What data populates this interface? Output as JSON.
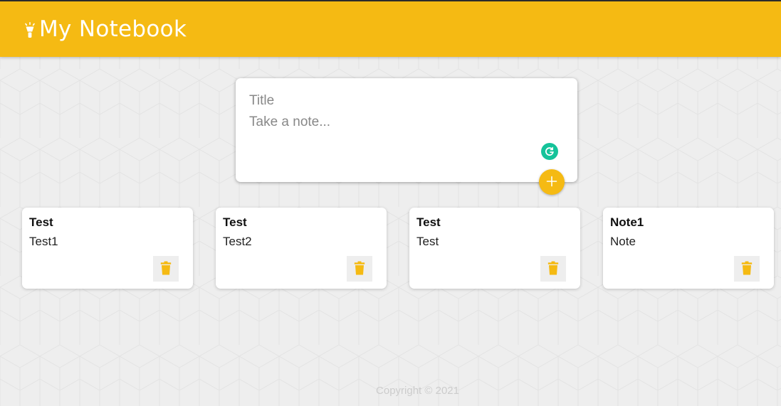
{
  "header": {
    "title": "My Notebook",
    "logo_icon": "lightbulb-icon",
    "color": "#f5ba13"
  },
  "composer": {
    "title_placeholder": "Title",
    "content_placeholder": "Take a note...",
    "add_icon": "plus-icon",
    "grammarly_icon": "grammarly-icon"
  },
  "notes": [
    {
      "title": "Test",
      "content": "Test1",
      "delete_icon": "trash-icon"
    },
    {
      "title": "Test",
      "content": "Test2",
      "delete_icon": "trash-icon"
    },
    {
      "title": "Test",
      "content": "Test",
      "delete_icon": "trash-icon"
    },
    {
      "title": "Note1",
      "content": "Note",
      "delete_icon": "trash-icon"
    }
  ],
  "footer": {
    "text": "Copyright © 2021"
  },
  "colors": {
    "accent": "#f5ba13",
    "background": "#eeeeee",
    "card": "#ffffff",
    "grammarly": "#15c39a"
  }
}
